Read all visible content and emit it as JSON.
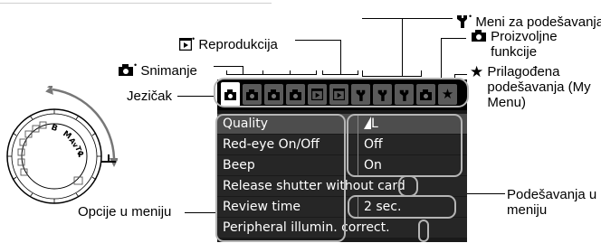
{
  "callouts": {
    "menu_settings": "Meni za podešavanja",
    "custom_functions": "Proizvoljne funkcije",
    "my_menu": "Prilagođena podešavanja (My Menu)",
    "playback": "Reprodukcija",
    "shooting": "Snimanje",
    "tab": "Jezičak",
    "menu_options": "Opcije u meniju",
    "menu_settings_values": "Podešavanja u meniju"
  },
  "tabs": [
    {
      "icon": "shooting-icon-1",
      "active": true
    },
    {
      "icon": "shooting-icon-2",
      "active": false
    },
    {
      "icon": "shooting-icon-3",
      "active": false
    },
    {
      "icon": "shooting-icon-4",
      "active": false
    },
    {
      "icon": "playback-icon-1",
      "active": false
    },
    {
      "icon": "playback-icon-2",
      "active": false
    },
    {
      "icon": "setup-icon-1",
      "active": false
    },
    {
      "icon": "setup-icon-2",
      "active": false
    },
    {
      "icon": "setup-icon-3",
      "active": false
    },
    {
      "icon": "custom-function-icon",
      "active": false
    },
    {
      "icon": "my-menu-star-icon",
      "active": false
    }
  ],
  "menu": {
    "rows": [
      {
        "label": "Quality",
        "value": "L",
        "selected": true
      },
      {
        "label": "Red-eye On/Off",
        "value": "Off",
        "selected": false
      },
      {
        "label": "Beep",
        "value": "On",
        "selected": false
      },
      {
        "label": "Release shutter without card",
        "value": "",
        "selected": false
      },
      {
        "label": "Review time",
        "value": "2 sec.",
        "selected": false
      },
      {
        "label": "Peripheral illumin. correct.",
        "value": "",
        "selected": false
      }
    ]
  },
  "dial": {
    "marks": [
      "B",
      "M",
      "Av",
      "Tv",
      "P"
    ]
  },
  "colors": {
    "screen_bg": "#1a1a1a",
    "row_bg": "#262626",
    "row_selected": "#4d4d4d",
    "tab_bg": "#5a5a5a",
    "tab_active": "#ffffff",
    "outline": "#b5b5b5"
  }
}
